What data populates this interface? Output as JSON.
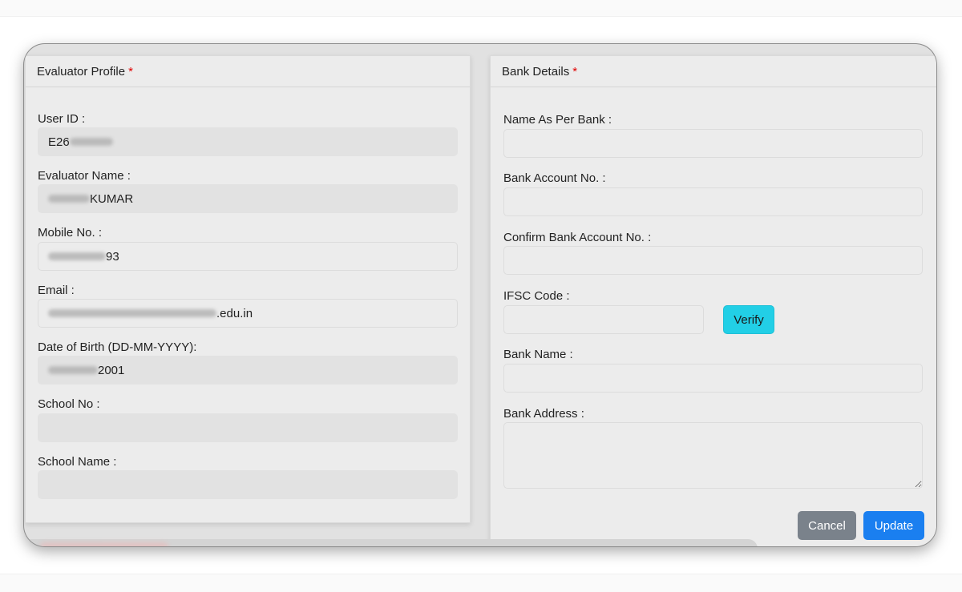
{
  "evaluator_profile": {
    "title": "Evaluator Profile",
    "required_marker": "*",
    "fields": {
      "user_id": {
        "label": "User ID :",
        "value": "E26"
      },
      "evaluator_name": {
        "label": "Evaluator Name :",
        "value": "KUMAR"
      },
      "mobile_no": {
        "label": "Mobile No. :",
        "value": "93"
      },
      "email": {
        "label": "Email :",
        "value": ".edu.in"
      },
      "dob": {
        "label": "Date of Birth (DD-MM-YYYY):",
        "value": "2001"
      },
      "school_no": {
        "label": "School No :",
        "value": ""
      },
      "school_name": {
        "label": "School Name :",
        "value": ""
      }
    }
  },
  "bank_details": {
    "title": "Bank Details",
    "required_marker": "*",
    "fields": {
      "name_as_per_bank": {
        "label": "Name As Per Bank :",
        "value": ""
      },
      "account_no": {
        "label": "Bank Account No. :",
        "value": ""
      },
      "confirm_account_no": {
        "label": "Confirm Bank Account No. :",
        "value": ""
      },
      "ifsc": {
        "label": "IFSC Code :",
        "value": ""
      },
      "bank_name": {
        "label": "Bank Name :",
        "value": ""
      },
      "bank_address": {
        "label": "Bank Address :",
        "value": ""
      }
    },
    "verify_label": "Verify",
    "cancel_label": "Cancel",
    "update_label": "Update"
  },
  "colors": {
    "verify": "#22cfe6",
    "cancel": "#7a828b",
    "update": "#1a7ff0",
    "required": "#e00000"
  }
}
